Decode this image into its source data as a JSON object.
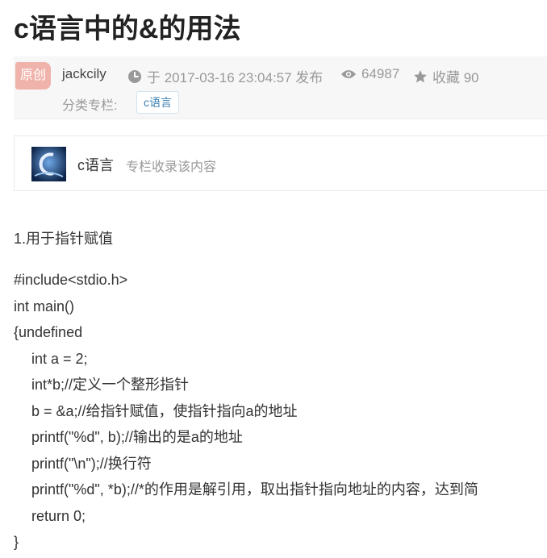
{
  "article": {
    "title": "c语言中的&的用法",
    "badge": "原创",
    "author": "jackcily",
    "published": "于 2017-03-16 23:04:57 发布",
    "views": "64987",
    "favorites": "收藏 90",
    "category_label": "分类专栏:",
    "category_tag": "c语言"
  },
  "column": {
    "name": "c语言",
    "description": "专栏收录该内容"
  },
  "content": {
    "heading": "1.用于指针赋值",
    "code": [
      "#include<stdio.h>",
      "int main()",
      "{undefined",
      "int a = 2;",
      "int*b;//定义一个整形指针",
      "b = &a;//给指针赋值，使指针指向a的地址",
      "printf(\"%d\", b);//输出的是a的地址",
      "printf(\"\\n\");//换行符",
      "printf(\"%d\", *b);//*的作用是解引用，取出指针指向地址的内容，达到简",
      "return 0;",
      "}"
    ]
  },
  "icons": {
    "clock": "clock-icon",
    "views": "eye-icon",
    "favorites": "star-icon"
  },
  "colors": {
    "badge_bg": "#f0b3ab",
    "meta_bg": "#f7f7f7",
    "tag_text": "#3a7fb3"
  }
}
